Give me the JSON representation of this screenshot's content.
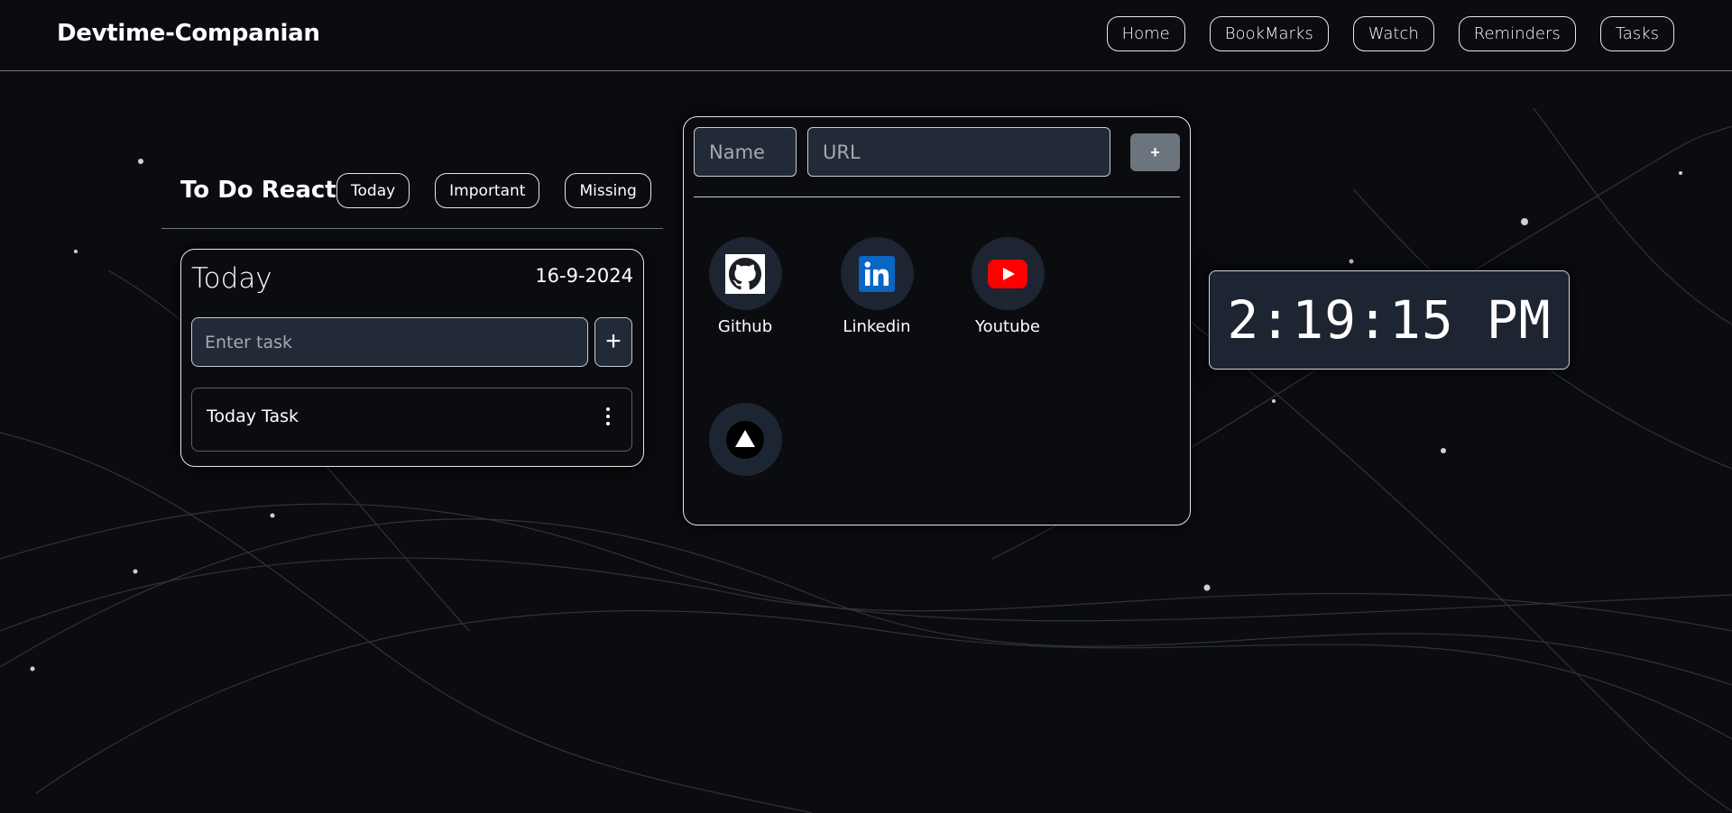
{
  "app": {
    "brand": "Devtime-Companian"
  },
  "nav": {
    "items": [
      "Home",
      "BookMarks",
      "Watch",
      "Reminders",
      "Tasks"
    ]
  },
  "todo": {
    "title": "To Do React",
    "filters": [
      "Today",
      "Important",
      "Missing"
    ],
    "card": {
      "label": "Today",
      "date": "16-9-2024",
      "input_placeholder": "Enter task",
      "add_label": "+",
      "tasks": [
        "Today Task"
      ]
    }
  },
  "bookmarks": {
    "name_placeholder": "Name",
    "url_placeholder": "URL",
    "add_label": "+",
    "items": [
      {
        "label": "Github",
        "icon": "github-icon"
      },
      {
        "label": "Linkedin",
        "icon": "linkedin-icon"
      },
      {
        "label": "Youtube",
        "icon": "youtube-icon"
      },
      {
        "label": "",
        "icon": "triangle-icon"
      }
    ]
  },
  "clock": {
    "time": "2:19:15 PM"
  },
  "colors": {
    "background": "#0b0c0f",
    "input_bg": "#222a38",
    "icon_circle": "#1e2532",
    "add_button": "#6c757d",
    "linkedin": "#0a66c2",
    "youtube": "#ff0000"
  }
}
